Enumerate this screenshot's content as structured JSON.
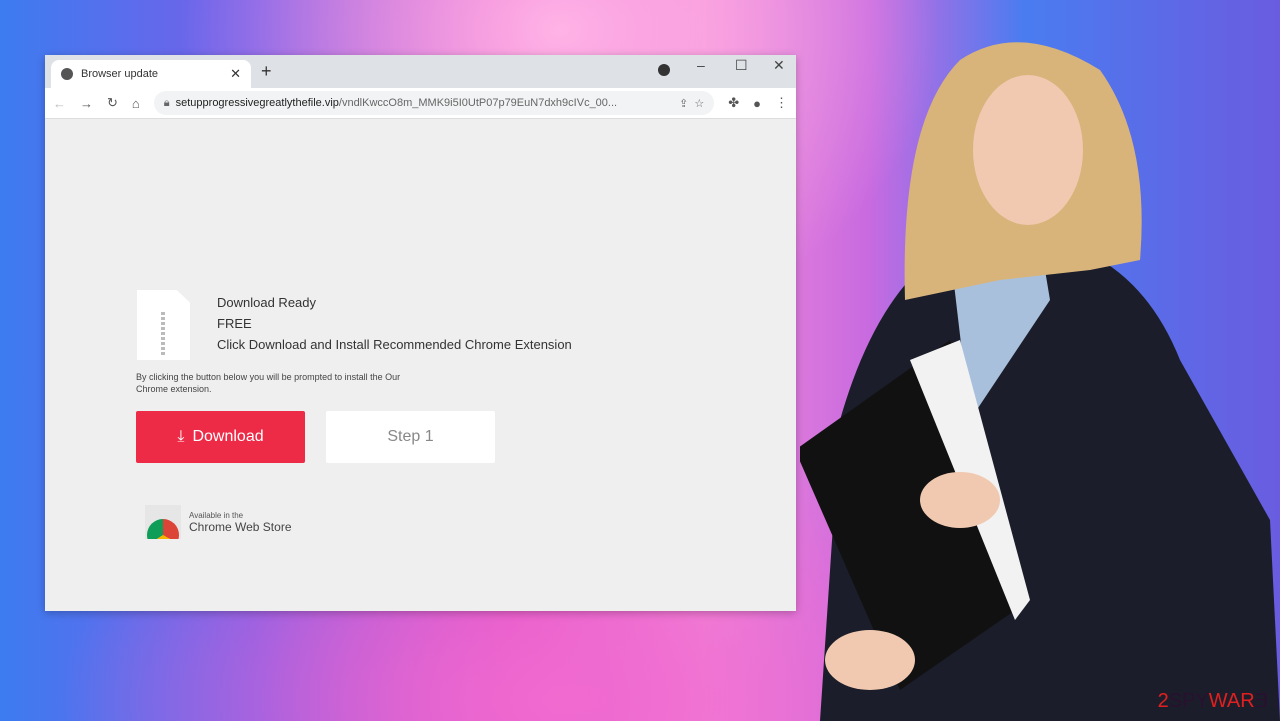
{
  "browser": {
    "tab_title": "Browser update",
    "url_domain": "setupprogressivegreatlythefile.vip",
    "url_path": "/vndlKwccO8m_MMK9i5I0UtP07p79EuN7dxh9cIVc_00..."
  },
  "page": {
    "line1": "Download Ready",
    "line2": "FREE",
    "line3": "Click Download and Install Recommended Chrome Extension",
    "note": "By clicking the button below you will be prompted to install the Our Chrome extension.",
    "download_label": "Download",
    "step_label": "Step 1",
    "store_small": "Available in the",
    "store_name": "Chrome Web Store"
  },
  "watermark": "2SPYWARE",
  "colors": {
    "download_button": "#ee2b47"
  }
}
